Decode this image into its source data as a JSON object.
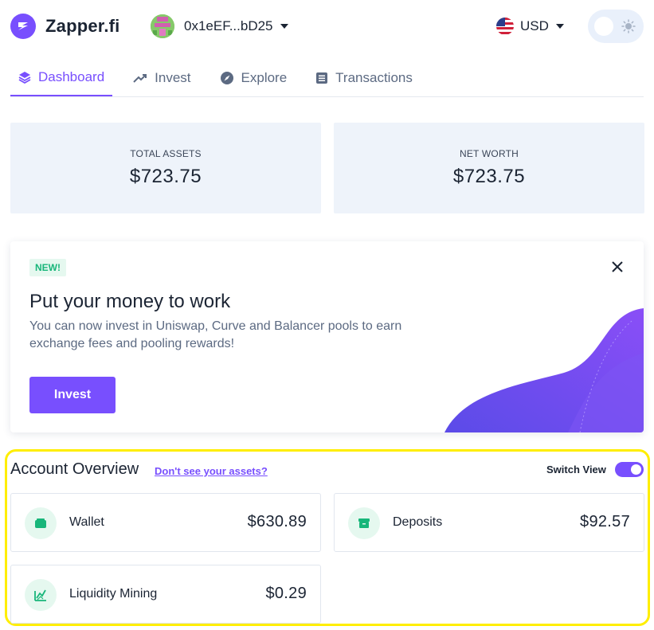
{
  "header": {
    "brand": "Zapper.fi",
    "wallet_address": "0x1eEF...bD25",
    "currency": "USD"
  },
  "tabs": [
    {
      "label": "Dashboard",
      "icon": "layers-icon",
      "active": true
    },
    {
      "label": "Invest",
      "icon": "trending-up-icon",
      "active": false
    },
    {
      "label": "Explore",
      "icon": "compass-icon",
      "active": false
    },
    {
      "label": "Transactions",
      "icon": "list-icon",
      "active": false
    }
  ],
  "stats": {
    "total_assets": {
      "label": "TOTAL ASSETS",
      "value": "$723.75"
    },
    "net_worth": {
      "label": "NET WORTH",
      "value": "$723.75"
    }
  },
  "promo": {
    "badge": "NEW!",
    "title": "Put your money to work",
    "text": "You can now invest in Uniswap, Curve and Balancer pools to earn exchange fees and pooling rewards!",
    "button": "Invest"
  },
  "overview": {
    "title": "Account Overview",
    "link": "Don't see your assets?",
    "switch_label": "Switch View",
    "switch_on": true,
    "accounts": [
      {
        "name": "Wallet",
        "value": "$630.89",
        "icon": "wallet-icon"
      },
      {
        "name": "Deposits",
        "value": "$92.57",
        "icon": "deposit-box-icon"
      },
      {
        "name": "Liquidity Mining",
        "value": "$0.29",
        "icon": "liquidity-mining-icon"
      }
    ]
  },
  "colors": {
    "accent": "#784ffe",
    "green": "#18b67a",
    "highlight": "#ffee00"
  }
}
